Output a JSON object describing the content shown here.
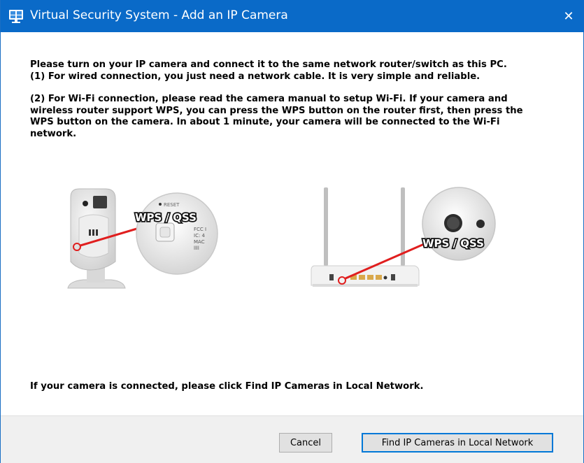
{
  "window": {
    "title": "Virtual Security System - Add an IP Camera",
    "close_glyph": "✕",
    "titlebar_color": "#0a6ac8"
  },
  "instructions": {
    "line1": "Please turn on your IP camera and connect it to the same network router/switch as this PC.",
    "line2": "(1) For wired connection, you just need a network cable. It is very simple and reliable.",
    "line3": "(2) For Wi-Fi connection, please read the camera manual to setup Wi-Fi. If your camera and",
    "line4": "wireless router support WPS, you can press the WPS button on the router first, then press the",
    "line5": "WPS button on the camera. In about 1 minute, your camera will be connected to the Wi-Fi",
    "line6": "network."
  },
  "illustrations": {
    "camera_badge": "WPS / QSS",
    "router_badge": "WPS / QSS",
    "camera_reset_label": "RESET",
    "camera_fcc_lines": [
      "FCC I",
      "IC: 4",
      "MAC",
      "llll"
    ]
  },
  "footer": {
    "message": "If your camera is connected, please click Find IP Cameras in Local Network.",
    "cancel_label": "Cancel",
    "find_label": "Find IP Cameras in Local Network"
  }
}
